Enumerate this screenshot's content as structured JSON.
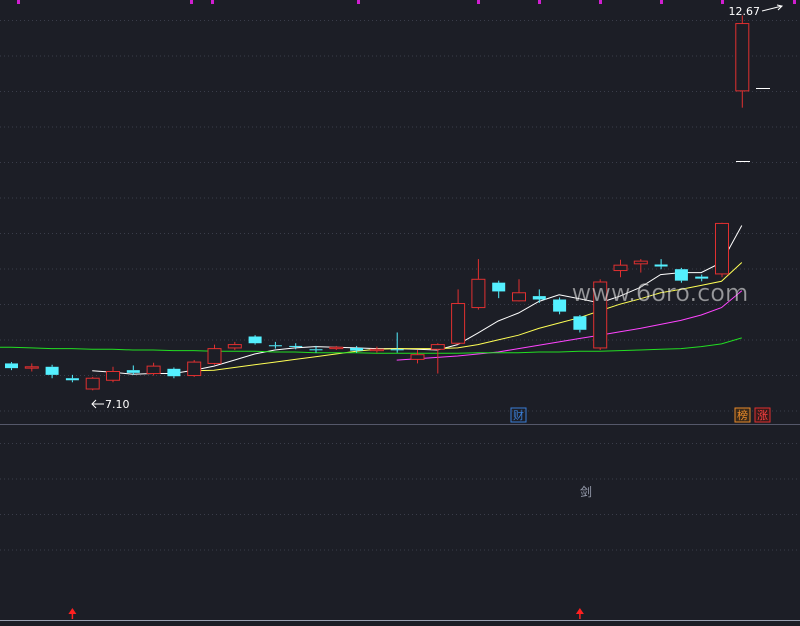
{
  "colors": {
    "background": "#1c1e26",
    "grid": "#3a3d4a",
    "up": "#e03030",
    "down": "#54f0ff",
    "ma5": "#ffffff",
    "ma10": "#ffff55",
    "ma20": "#ff44ff",
    "ma60": "#22dd22",
    "divider": "#55586a",
    "top_marker": "#d01fd0",
    "signal_arrow": "#ff2020",
    "label_text": "#ffffff",
    "tag_blue": "#3a7fd8",
    "tag_orange": "#e88a2a",
    "tag_red": "#e03030"
  },
  "labels": {
    "high_price": "12.67",
    "low_price": "7.10",
    "tag_cai": "财",
    "tag_bang": "榜",
    "tag_zhang": "涨",
    "watermark": "www.6oro.com",
    "lower_glyph": "剑"
  },
  "chart_data": {
    "type": "candlestick",
    "title": "",
    "xlabel": "",
    "ylabel": "",
    "ylim": [
      6.6,
      12.9
    ],
    "grid": true,
    "candles": [
      {
        "o": 7.5,
        "c": 7.43,
        "h": 7.52,
        "l": 7.4
      },
      {
        "o": 7.43,
        "c": 7.45,
        "h": 7.5,
        "l": 7.38
      },
      {
        "o": 7.45,
        "c": 7.33,
        "h": 7.48,
        "l": 7.28
      },
      {
        "o": 7.28,
        "c": 7.25,
        "h": 7.33,
        "l": 7.22
      },
      {
        "o": 7.12,
        "c": 7.28,
        "h": 7.3,
        "l": 7.1
      },
      {
        "o": 7.25,
        "c": 7.38,
        "h": 7.45,
        "l": 7.22
      },
      {
        "o": 7.4,
        "c": 7.36,
        "h": 7.47,
        "l": 7.33
      },
      {
        "o": 7.35,
        "c": 7.46,
        "h": 7.51,
        "l": 7.32
      },
      {
        "o": 7.42,
        "c": 7.31,
        "h": 7.44,
        "l": 7.28
      },
      {
        "o": 7.32,
        "c": 7.52,
        "h": 7.55,
        "l": 7.3
      },
      {
        "o": 7.5,
        "c": 7.72,
        "h": 7.78,
        "l": 7.48
      },
      {
        "o": 7.73,
        "c": 7.78,
        "h": 7.82,
        "l": 7.7
      },
      {
        "o": 7.9,
        "c": 7.8,
        "h": 7.92,
        "l": 7.78
      },
      {
        "o": 7.77,
        "c": 7.76,
        "h": 7.82,
        "l": 7.72
      },
      {
        "o": 7.76,
        "c": 7.75,
        "h": 7.8,
        "l": 7.71
      },
      {
        "o": 7.71,
        "c": 7.7,
        "h": 7.76,
        "l": 7.66
      },
      {
        "o": 7.72,
        "c": 7.74,
        "h": 7.76,
        "l": 7.7
      },
      {
        "o": 7.73,
        "c": 7.69,
        "h": 7.76,
        "l": 7.66
      },
      {
        "o": 7.69,
        "c": 7.71,
        "h": 7.75,
        "l": 7.66
      },
      {
        "o": 7.71,
        "c": 7.7,
        "h": 7.96,
        "l": 7.66
      },
      {
        "o": 7.56,
        "c": 7.63,
        "h": 7.7,
        "l": 7.5
      },
      {
        "o": 7.71,
        "c": 7.78,
        "h": 7.8,
        "l": 7.35
      },
      {
        "o": 7.8,
        "c": 8.39,
        "h": 8.6,
        "l": 7.78
      },
      {
        "o": 8.33,
        "c": 8.75,
        "h": 9.05,
        "l": 8.3
      },
      {
        "o": 8.7,
        "c": 8.57,
        "h": 8.73,
        "l": 8.47
      },
      {
        "o": 8.43,
        "c": 8.55,
        "h": 8.75,
        "l": 8.42
      },
      {
        "o": 8.5,
        "c": 8.45,
        "h": 8.6,
        "l": 8.4
      },
      {
        "o": 8.45,
        "c": 8.27,
        "h": 8.48,
        "l": 8.23
      },
      {
        "o": 8.2,
        "c": 8.0,
        "h": 8.22,
        "l": 7.96
      },
      {
        "o": 7.73,
        "c": 8.71,
        "h": 8.75,
        "l": 7.7
      },
      {
        "o": 8.88,
        "c": 8.96,
        "h": 9.04,
        "l": 8.78
      },
      {
        "o": 8.98,
        "c": 9.02,
        "h": 9.05,
        "l": 8.85
      },
      {
        "o": 8.97,
        "c": 8.94,
        "h": 9.05,
        "l": 8.9
      },
      {
        "o": 8.9,
        "c": 8.73,
        "h": 8.92,
        "l": 8.7
      },
      {
        "o": 8.79,
        "c": 8.76,
        "h": 8.82,
        "l": 8.72
      },
      {
        "o": 8.83,
        "c": 9.58,
        "h": 9.59,
        "l": 8.78
      },
      {
        "o": 11.55,
        "c": 12.55,
        "h": 12.67,
        "l": 11.3
      }
    ],
    "series": [
      {
        "name": "",
        "color_key": "ma5",
        "values": [
          null,
          null,
          null,
          null,
          7.39,
          7.37,
          7.34,
          7.35,
          7.35,
          7.4,
          7.46,
          7.55,
          7.64,
          7.7,
          7.73,
          7.75,
          7.74,
          7.73,
          7.72,
          7.72,
          7.71,
          7.7,
          7.78,
          7.95,
          8.13,
          8.25,
          8.42,
          8.52,
          8.46,
          8.4,
          8.5,
          8.63,
          8.82,
          8.85,
          8.85,
          9.0,
          9.55
        ]
      },
      {
        "name": "",
        "color_key": "ma10",
        "values": [
          null,
          null,
          null,
          null,
          null,
          null,
          null,
          null,
          null,
          7.39,
          7.4,
          7.44,
          7.48,
          7.52,
          7.56,
          7.6,
          7.64,
          7.68,
          7.71,
          7.72,
          7.72,
          7.72,
          7.73,
          7.78,
          7.85,
          7.92,
          8.02,
          8.1,
          8.18,
          8.28,
          8.38,
          8.46,
          8.55,
          8.6,
          8.66,
          8.72,
          9.0
        ]
      },
      {
        "name": "",
        "color_key": "ma20",
        "values": [
          null,
          null,
          null,
          null,
          null,
          null,
          null,
          null,
          null,
          null,
          null,
          null,
          null,
          null,
          null,
          null,
          null,
          null,
          null,
          7.55,
          7.57,
          7.59,
          7.61,
          7.64,
          7.67,
          7.72,
          7.77,
          7.82,
          7.87,
          7.92,
          7.97,
          8.02,
          8.08,
          8.14,
          8.22,
          8.33,
          8.58
        ]
      },
      {
        "name": "",
        "color_key": "ma60",
        "values": [
          7.74,
          7.73,
          7.72,
          7.72,
          7.71,
          7.71,
          7.7,
          7.7,
          7.69,
          7.69,
          7.68,
          7.68,
          7.68,
          7.67,
          7.67,
          7.66,
          7.66,
          7.66,
          7.65,
          7.65,
          7.65,
          7.65,
          7.65,
          7.66,
          7.66,
          7.66,
          7.67,
          7.67,
          7.68,
          7.68,
          7.69,
          7.7,
          7.71,
          7.72,
          7.75,
          7.79,
          7.88
        ]
      }
    ],
    "annotations": [
      {
        "text": "12.67",
        "candle": 36,
        "value": 12.67
      },
      {
        "text": "7.10",
        "candle": 4,
        "value": 7.1
      }
    ],
    "signals": [
      3,
      28
    ]
  }
}
